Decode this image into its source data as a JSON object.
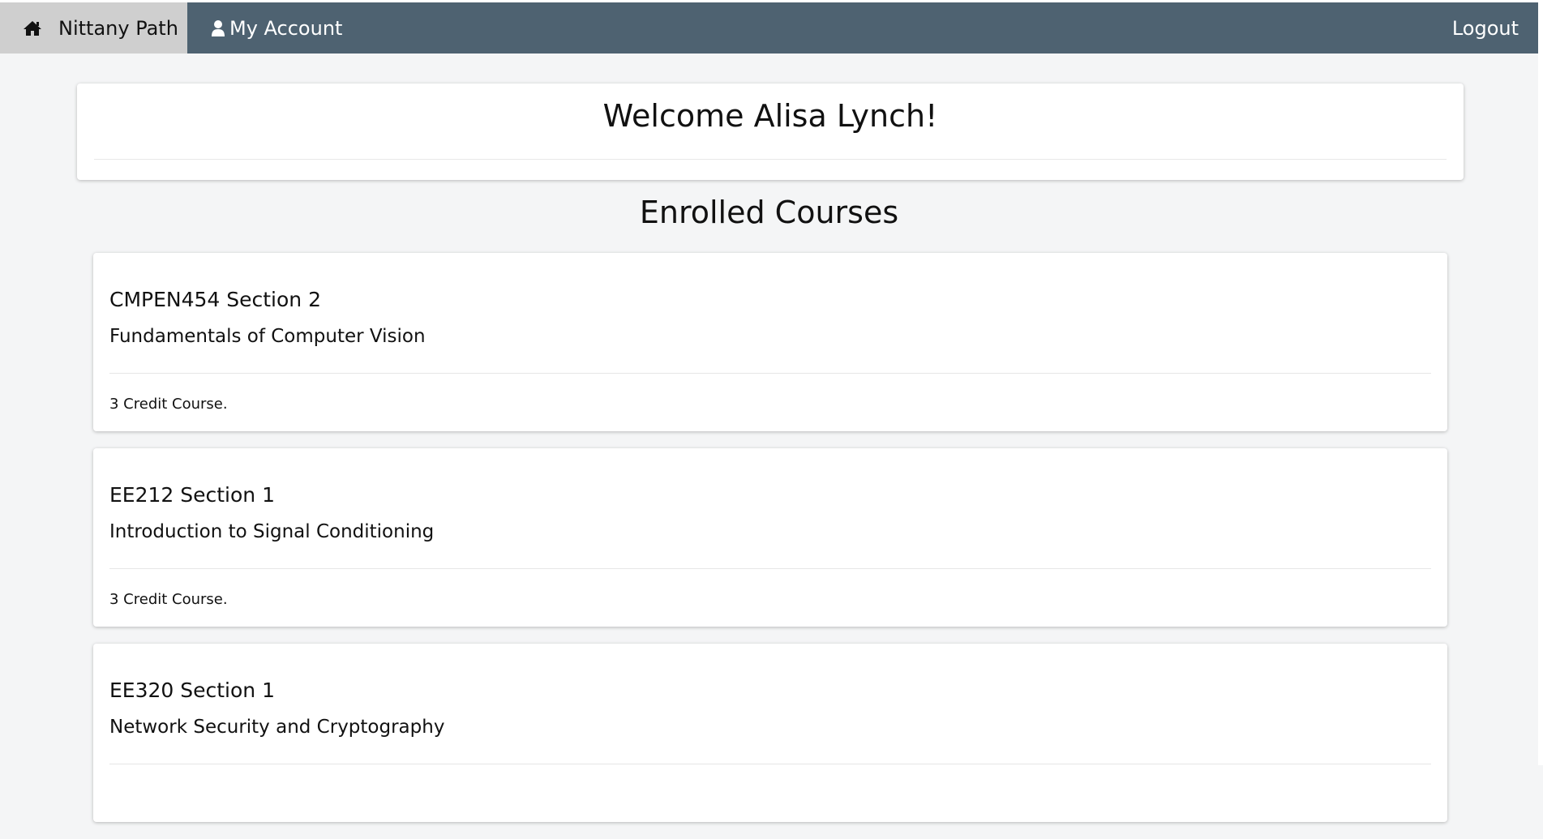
{
  "nav": {
    "home_label": "Nittany Path",
    "home_icon": "home-icon",
    "account_label": "My Account",
    "account_icon": "user-icon",
    "logout_label": "Logout",
    "bar_color": "#4e6271",
    "home_bg_color": "#cfcfcf"
  },
  "welcome": {
    "title": "Welcome Alisa Lynch!"
  },
  "courses_section": {
    "title": "Enrolled Courses",
    "courses": [
      {
        "code": "CMPEN454 Section 2",
        "name": "Fundamentals of Computer Vision",
        "credits": "3 Credit Course."
      },
      {
        "code": "EE212 Section 1",
        "name": "Introduction to Signal Conditioning",
        "credits": "3 Credit Course."
      },
      {
        "code": "EE320 Section 1",
        "name": "Network Security and Cryptography",
        "credits": ""
      }
    ]
  }
}
